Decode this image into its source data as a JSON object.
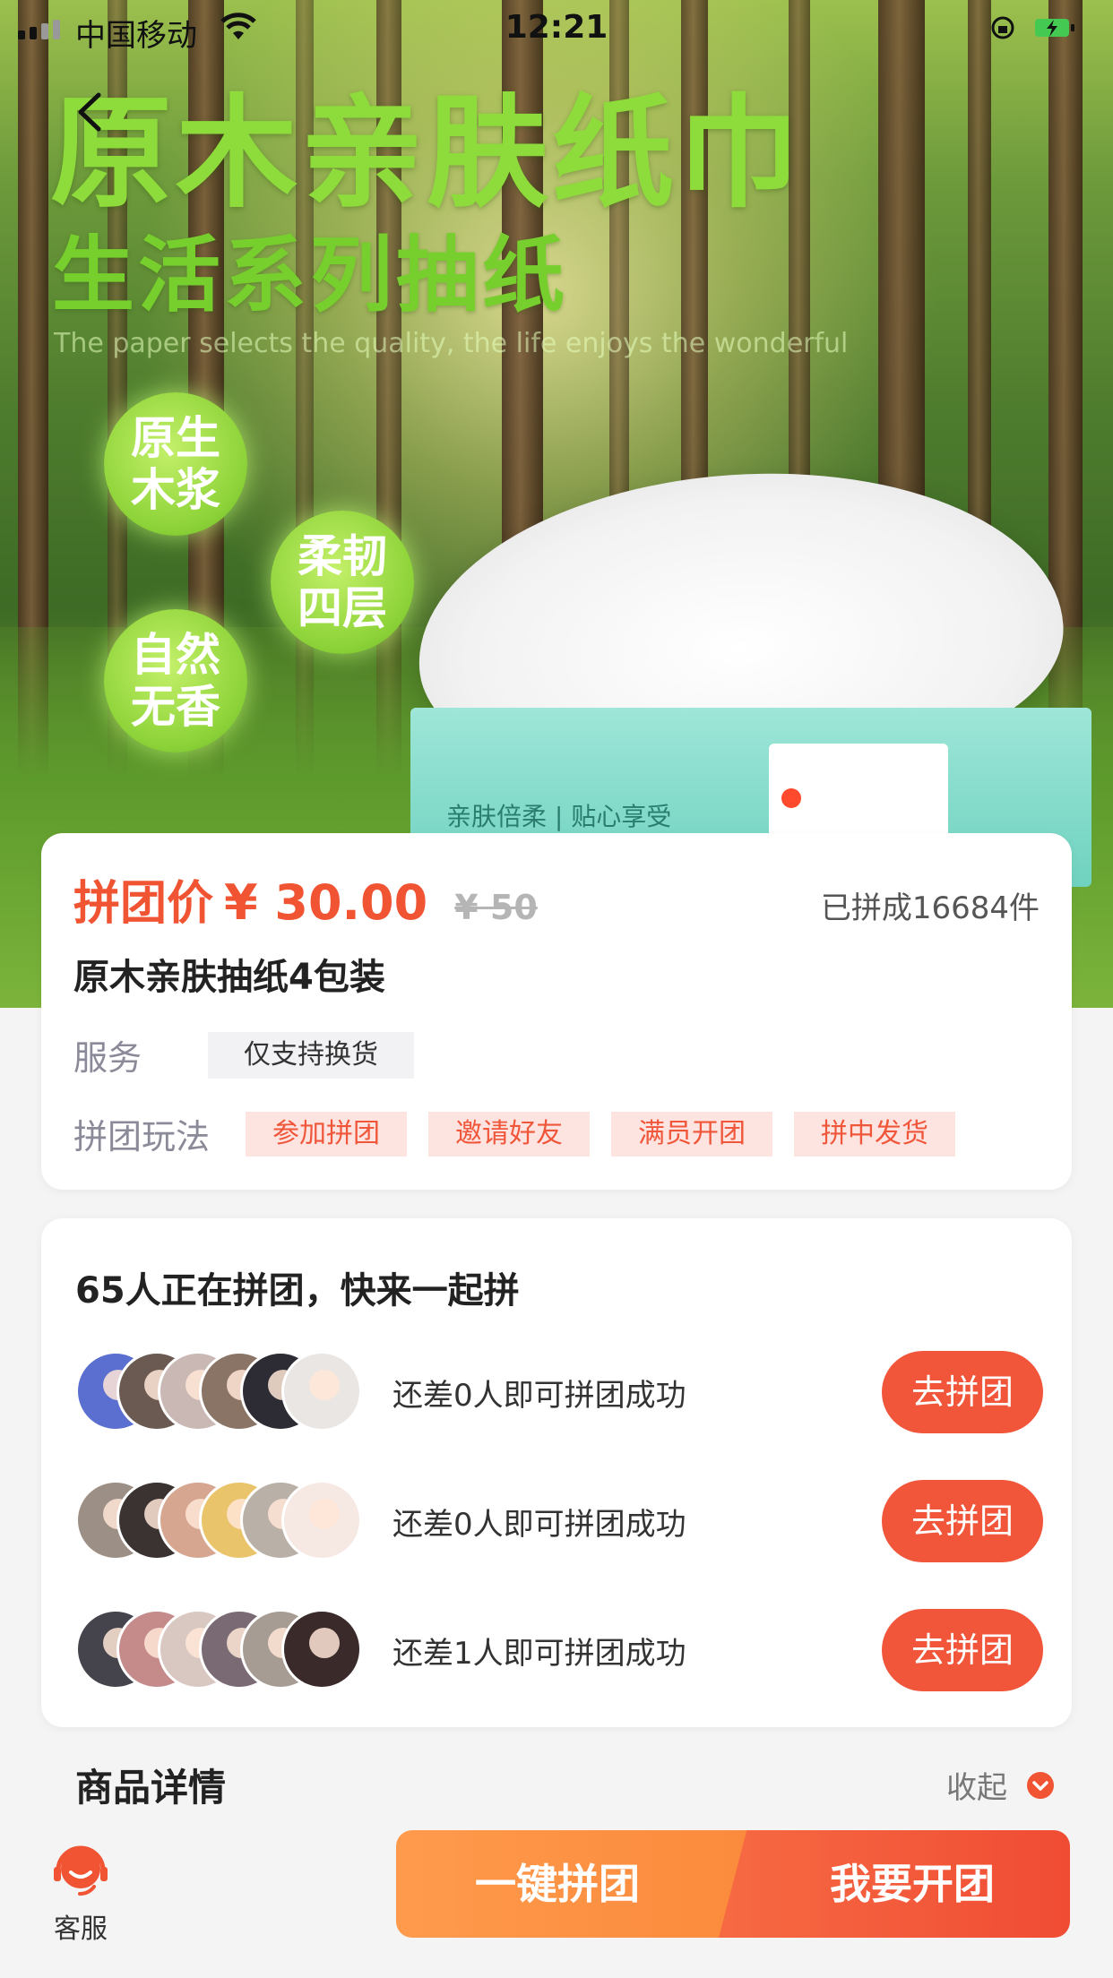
{
  "status_bar": {
    "carrier": "中国移动",
    "time": "12:21"
  },
  "hero": {
    "title": "原木亲肤纸巾",
    "subtitle": "生活系列抽纸",
    "tagline": "The paper selects the quality, the life enjoys the wonderful",
    "features": [
      "原生木浆",
      "柔韧四层",
      "自然无香"
    ],
    "box_text": "亲肤倍柔 | 贴心享受"
  },
  "product": {
    "price_label": "拼团价",
    "price": "¥ 30.00",
    "original_price": "¥ 50",
    "sold": "已拼成16684件",
    "name": "原木亲肤抽纸4包装",
    "service_label": "服务",
    "service_tag": "仅支持换货",
    "play_label": "拼团玩法",
    "play_steps": [
      "参加拼团",
      "邀请好友",
      "满员开团",
      "拼中发货"
    ]
  },
  "groups": {
    "title": "65人正在拼团，快来一起拼",
    "rows": [
      {
        "text": "还差0人即可拼团成功",
        "button": "去拼团"
      },
      {
        "text": "还差0人即可拼团成功",
        "button": "去拼团"
      },
      {
        "text": "还差1人即可拼团成功",
        "button": "去拼团"
      }
    ]
  },
  "details": {
    "title": "商品详情",
    "toggle": "收起"
  },
  "bottom_bar": {
    "service": "客服",
    "one_click": "一键拼团",
    "open_group": "我要开团"
  },
  "colors": {
    "accent": "#f05433",
    "orange": "#fb8a3c",
    "tag_bg": "#fde4e1"
  }
}
